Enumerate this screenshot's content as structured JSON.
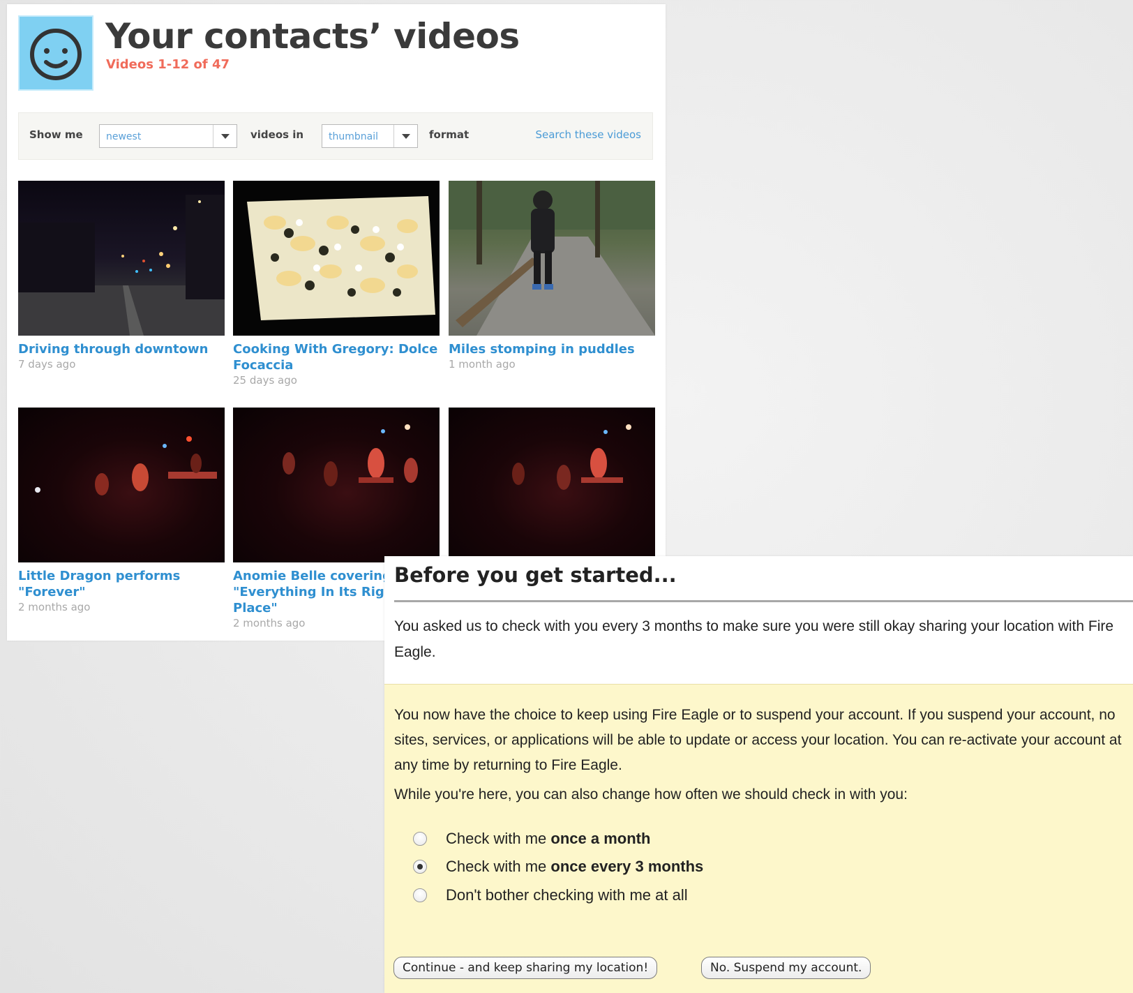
{
  "videos_page": {
    "title": "Your contacts’ videos",
    "subtitle": "Videos 1-12 of 47",
    "avatar_icon": "smiley-face-icon",
    "filter": {
      "show_me_label": "Show me",
      "sort_value": "newest",
      "videos_in_label": "videos in",
      "format_value": "thumbnail",
      "format_label": "format",
      "search_link": "Search these videos"
    },
    "videos": [
      {
        "title": "Driving through downtown",
        "title2": "",
        "age": "7 days ago",
        "thumb": "night-street"
      },
      {
        "title": "Cooking With Gregory: Dolce",
        "title2": "Focaccia",
        "age": "25 days ago",
        "thumb": "focaccia"
      },
      {
        "title": "Miles stomping in puddles",
        "title2": "",
        "age": "1 month ago",
        "thumb": "forest-path"
      },
      {
        "title": "Little Dragon performs",
        "title2": "\"Forever\"",
        "title3": "",
        "age": "2 months ago",
        "thumb": "concert"
      },
      {
        "title": "Anomie Belle covering",
        "title2": "\"Everything In Its Right",
        "title3": "Place\"",
        "age": "2 months ago",
        "thumb": "concert"
      },
      {
        "title": "",
        "title2": "",
        "age": "",
        "thumb": "concert"
      }
    ]
  },
  "fire_eagle": {
    "heading": "Before you get started...",
    "intro": "You asked us to check with you every 3 months to make sure you were still okay sharing your location with Fire Eagle.",
    "body": "You now have the choice to keep using Fire Eagle or to suspend your account. If you suspend your account, no sites, services, or applications will be able to update or access your location. You can re-activate your account at any time by returning to Fire Eagle.",
    "question": "While you're here, you can also change how often we should check in with you:",
    "options": [
      {
        "prefix": "Check with me ",
        "bold": "once a month",
        "checked": false
      },
      {
        "prefix": "Check with me ",
        "bold": "once every 3 months",
        "checked": true
      },
      {
        "prefix": "Don't bother checking with me at all",
        "bold": "",
        "checked": false
      }
    ],
    "continue_button": "Continue - and keep sharing my location!",
    "suspend_button": "No. Suspend my account."
  }
}
